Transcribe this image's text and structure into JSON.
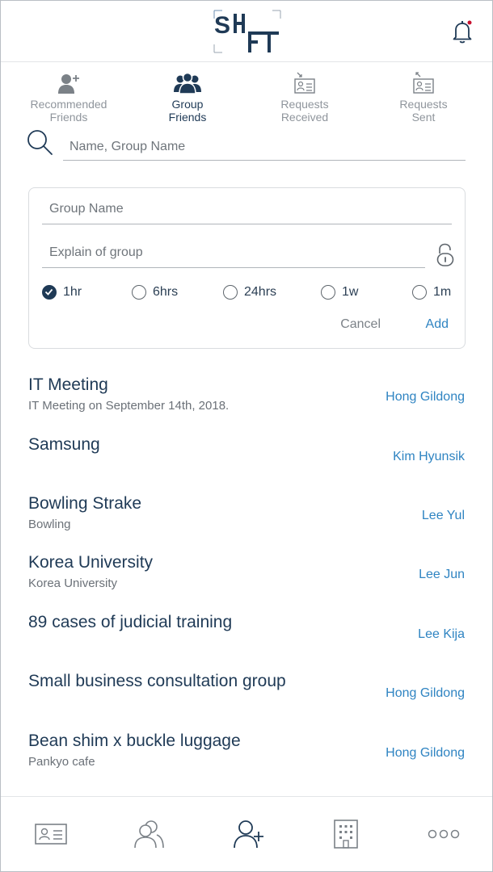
{
  "app": {
    "logo_text": "SHIFT"
  },
  "header": {
    "notification_icon": "bell-icon",
    "accent": "#c8102e"
  },
  "tabs": [
    {
      "label": "Recommended\nFriends",
      "icon": "add-person-icon",
      "active": false
    },
    {
      "label": "Group\nFriends",
      "icon": "group-people-icon",
      "active": true
    },
    {
      "label": "Requests\nReceived",
      "icon": "id-card-received-icon",
      "active": false
    },
    {
      "label": "Requests\nSent",
      "icon": "id-card-sent-icon",
      "active": false
    }
  ],
  "search": {
    "placeholder": "Name, Group Name",
    "value": ""
  },
  "create_group": {
    "name_placeholder": "Group Name",
    "explain_placeholder": "Explain of group",
    "lock_icon": "unlock-icon",
    "durations": [
      {
        "label": "1hr",
        "checked": true
      },
      {
        "label": "6hrs",
        "checked": false
      },
      {
        "label": "24hrs",
        "checked": false
      },
      {
        "label": "1w",
        "checked": false
      },
      {
        "label": "1m",
        "checked": false
      }
    ],
    "cancel_label": "Cancel",
    "add_label": "Add"
  },
  "groups": [
    {
      "name": "IT Meeting",
      "description": "IT Meeting on September 14th, 2018.",
      "owner": "Hong Gildong"
    },
    {
      "name": "Samsung",
      "description": "",
      "owner": "Kim Hyunsik"
    },
    {
      "name": "Bowling Strake",
      "description": "Bowling",
      "owner": "Lee Yul"
    },
    {
      "name": "Korea University",
      "description": "Korea University",
      "owner": "Lee Jun"
    },
    {
      "name": "89 cases of judicial training",
      "description": "",
      "owner": "Lee Kija"
    },
    {
      "name": "Small business consultation group",
      "description": "",
      "owner": "Hong Gildong"
    },
    {
      "name": "Bean shim x buckle luggage",
      "description": "Pankyo cafe",
      "owner": "Hong Gildong"
    }
  ],
  "bottom_nav": [
    {
      "icon": "profile-card-icon"
    },
    {
      "icon": "friends-icon"
    },
    {
      "icon": "add-friend-icon",
      "active": true
    },
    {
      "icon": "building-icon"
    },
    {
      "icon": "more-icon"
    }
  ],
  "colors": {
    "primary": "#1f3a56",
    "link": "#2f84c2",
    "muted": "#8f959c"
  }
}
